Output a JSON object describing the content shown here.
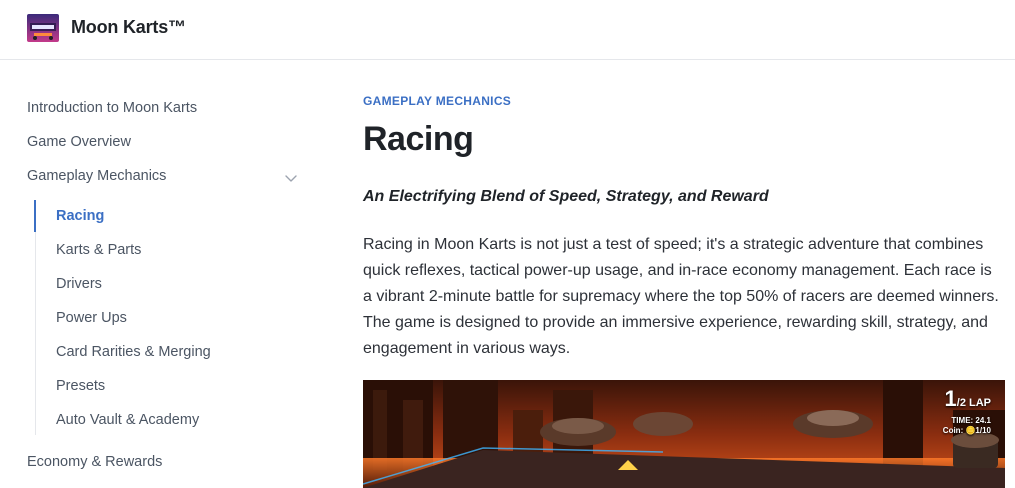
{
  "header": {
    "site_title": "Moon Karts™",
    "logo_icon": "moon-karts-logo-icon"
  },
  "sidebar": {
    "items": [
      {
        "label": "Introduction to Moon Karts"
      },
      {
        "label": "Game Overview"
      },
      {
        "label": "Gameplay Mechanics",
        "expanded": true,
        "icon": "chevron-down-icon"
      },
      {
        "label": "Economy & Rewards"
      }
    ],
    "subitems": [
      {
        "label": "Racing",
        "active": true
      },
      {
        "label": "Karts & Parts"
      },
      {
        "label": "Drivers"
      },
      {
        "label": "Power Ups"
      },
      {
        "label": "Card Rarities & Merging"
      },
      {
        "label": "Presets"
      },
      {
        "label": "Auto Vault & Academy"
      }
    ]
  },
  "main": {
    "eyebrow": "GAMEPLAY MECHANICS",
    "title": "Racing",
    "subtitle": "An Electrifying Blend of Speed, Strategy, and Reward",
    "body": "Racing in Moon Karts is not just a test of speed; it's a strategic adventure that combines quick reflexes, tactical power-up usage, and in-race economy management. Each race is a vibrant 2-minute battle for supremacy where the top 50% of racers are deemed winners. The game is designed to provide an immersive experience, rewarding skill, strategy, and engagement in various ways.",
    "hero": {
      "lap_current": "1",
      "lap_rest": "/2 LAP",
      "time": "TIME: 24.1",
      "coin": "Coin: 🪙1/10"
    }
  },
  "colors": {
    "accent": "#3b6fc4",
    "text": "#1f2328",
    "muted": "#4b5563",
    "divider": "#e5e7eb"
  }
}
